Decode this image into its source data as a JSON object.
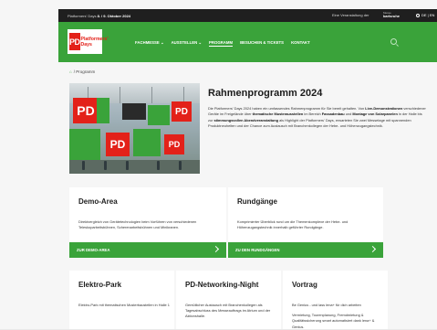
{
  "topbar": {
    "dates_prefix": "Platformers' Days",
    "dates_bold": "8. / 9. Oktober 2024",
    "organizer_label": "Eine Veranstaltung der",
    "organizer_small": "Messe",
    "organizer_name": "karlsruhe",
    "language": "DE | EN"
  },
  "logo": {
    "mark": "PD",
    "line1": "Platformers'",
    "line2": "Days"
  },
  "nav": {
    "items": [
      {
        "label": "FACHMESSE"
      },
      {
        "label": "AUSSTELLEN"
      },
      {
        "label": "PROGRAMM"
      },
      {
        "label": "BESUCHEN & TICKETS"
      },
      {
        "label": "KONTAKT"
      }
    ]
  },
  "breadcrumb": {
    "current": "Programm"
  },
  "hero": {
    "title": "Rahmenprogramm 2024",
    "text_1": "Die Platformers' Days 2024 haben ein umfassendes Rahmenprogramm für Sie bereit gehalten. Von ",
    "bold_1": "Live-Demonstrationen",
    "text_2": " verschiedener Geräte im Freigelände über ",
    "bold_2": "thematische Musterausstellen",
    "text_3": " im Bereich ",
    "bold_3": "Fassadenbau",
    "text_4": " und ",
    "bold_4": "Montage von Solarpanelen",
    "text_5": " in der Halle bis zur ",
    "bold_5": "stimmungsvollen Abendveranstaltung",
    "text_6": " als Highlight der Platformers' Days, erwarteten Sie zwei Messetage mit spannenden Produktneuheiten und der Chance zum Austausch mit Branchenkollegen der Hebe- und Höhenzugangstechnik."
  },
  "cards": {
    "demo": {
      "title": "Demo-Area",
      "text": "Direktvergleich von Gerätetechnologien beim Vorführen von verschiedenen Teleskoparbeitsbühnen, Scherenarbeitsbühnen und Minikranen.",
      "cta": "ZUR DEMO-AREA"
    },
    "rundgaenge": {
      "title": "Rundgänge",
      "text": "Komprimierter Überblick rund um die Themenkomplexe der Hebe- und Höhenzugangstechnik innerhalb geführter Rundgänge.",
      "cta": "ZU DEN RUNDGÄNGEN"
    },
    "elektro": {
      "title": "Elektro-Park",
      "text": "Elektro-Park mit thematischen Musterbaustellen in Halle 1"
    },
    "networking": {
      "title": "PD-Networking-Night",
      "text": "Gemütlicher Austausch mit Branchenkollegen als Tagesabschluss des Messeauftrags im Atrium und der Aktionshalle."
    },
    "vortrag": {
      "title": "Vortrag",
      "text_1": "Be Genius - und lass lena+ für dich arbeiten",
      "text_2": "Vermietung, Tourenplanung, Fremdmietung & Qualitätssicherung smart automatisiert dank lena+ & Genius."
    }
  },
  "colors": {
    "brand_green": "#3aa33a",
    "brand_red": "#e32119"
  }
}
